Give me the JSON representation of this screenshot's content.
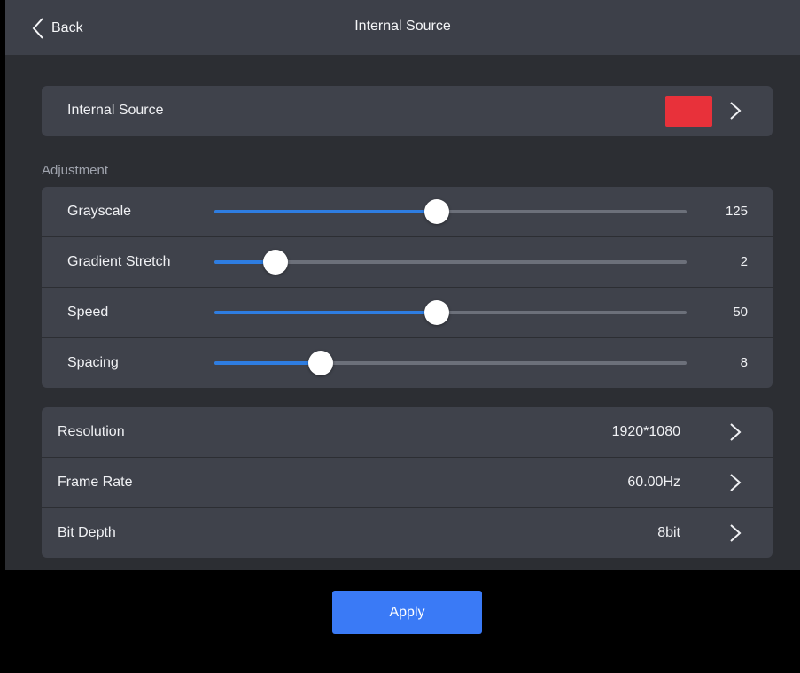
{
  "header": {
    "back_label": "Back",
    "title": "Internal Source"
  },
  "source": {
    "label": "Internal Source",
    "swatch_color": "#e8313a"
  },
  "adjustment": {
    "section_label": "Adjustment",
    "sliders": [
      {
        "label": "Grayscale",
        "value": "125",
        "fraction": 0.47
      },
      {
        "label": "Gradient Stretch",
        "value": "2",
        "fraction": 0.13
      },
      {
        "label": "Speed",
        "value": "50",
        "fraction": 0.47
      },
      {
        "label": "Spacing",
        "value": "8",
        "fraction": 0.226
      }
    ]
  },
  "video": [
    {
      "label": "Resolution",
      "value": "1920*1080"
    },
    {
      "label": "Frame Rate",
      "value": "60.00Hz"
    },
    {
      "label": "Bit Depth",
      "value": "8bit"
    }
  ],
  "footer": {
    "apply_label": "Apply",
    "apply_color": "#3a7af6"
  },
  "icons": {
    "back": "chevron-left-icon",
    "row_arrow": "chevron-right-icon"
  }
}
